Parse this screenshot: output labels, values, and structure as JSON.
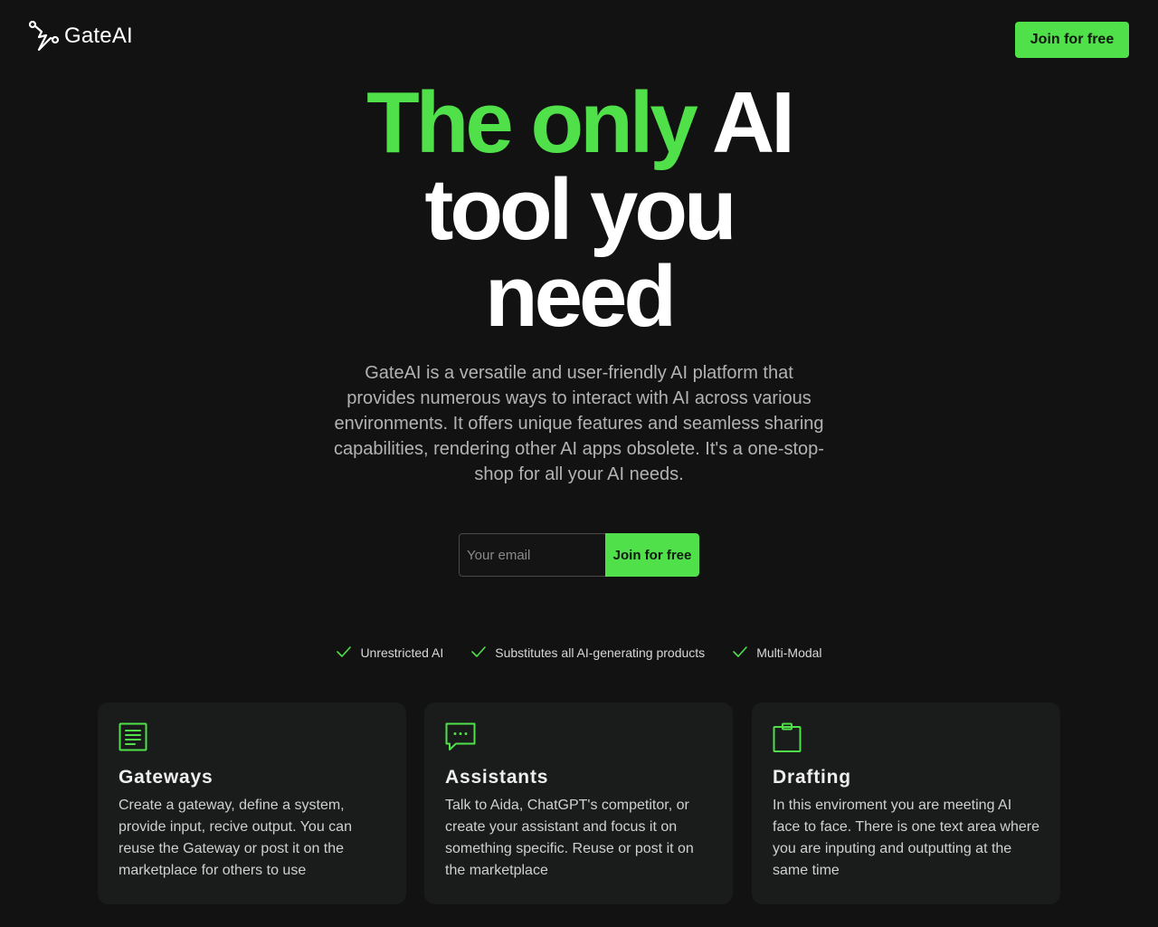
{
  "colors": {
    "background": "#121212",
    "accent": "#4fe04a",
    "card_background": "#1a1b1b",
    "muted_text": "#b3b3b3"
  },
  "header": {
    "logo_icon": "path-nodes-icon",
    "logo_text": "GateAI",
    "join_button_label": "Join for free"
  },
  "hero": {
    "title_green": "The only",
    "title_white_1": "AI",
    "title_white_2": "tool you",
    "title_white_3": "need",
    "description": "GateAI is a versatile and user-friendly AI platform that provides numerous ways to interact with AI across various environments. It offers unique features and seamless sharing capabilities, rendering other AI apps obsolete. It's a one-stop-shop for all your AI needs."
  },
  "signup": {
    "email_placeholder": "Your email",
    "email_value": "",
    "button_label": "Join for free"
  },
  "features": [
    {
      "icon": "check-icon",
      "label": "Unrestricted AI"
    },
    {
      "icon": "check-icon",
      "label": "Substitutes all AI-generating products"
    },
    {
      "icon": "check-icon",
      "label": "Multi-Modal"
    }
  ],
  "cards": [
    {
      "icon": "document-list-icon",
      "title": "Gateways",
      "body": "Create a gateway, define a system, provide input, recive output. You can reuse the Gateway or post it on the marketplace for others to use"
    },
    {
      "icon": "chat-bubble-icon",
      "title": "Assistants",
      "body": "Talk to Aida, ChatGPT's competitor, or create your assistant and focus it on something specific. Reuse or post it on the marketplace"
    },
    {
      "icon": "clipboard-icon",
      "title": "Drafting",
      "body": "In this enviroment you are meeting AI face to face. There is one text area where you are inputing and outputting at the same time"
    }
  ]
}
